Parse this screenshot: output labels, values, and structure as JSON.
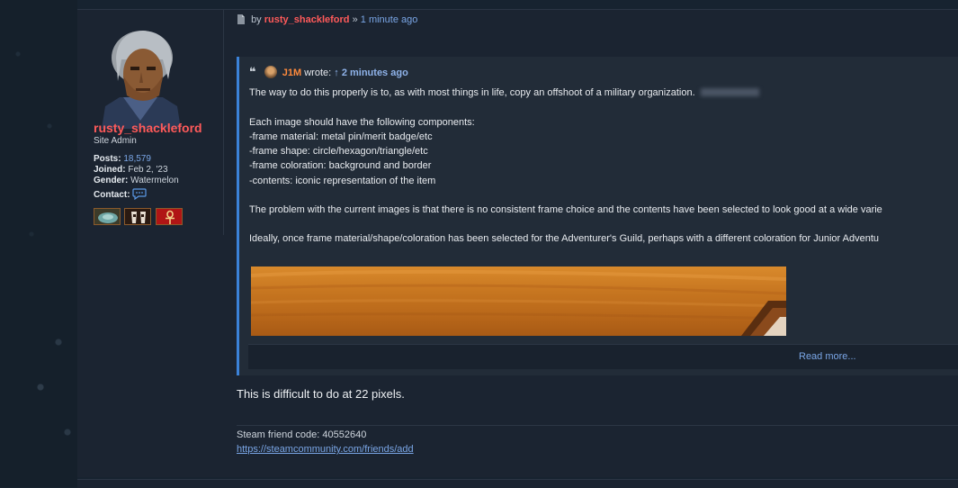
{
  "post": {
    "meta": {
      "prefix": "by",
      "author": "rusty_shackleford",
      "separator": "»",
      "time": "1 minute ago"
    },
    "profile": {
      "username": "rusty_shackleford",
      "rank": "Site Admin",
      "posts_label": "Posts:",
      "posts_value": "18,579",
      "joined_label": "Joined:",
      "joined_value": "Feb 2, '23",
      "gender_label": "Gender:",
      "gender_value": "Watermelon",
      "contact_label": "Contact:",
      "badges": [
        "badge-1",
        "badge-2",
        "badge-3"
      ]
    },
    "quote": {
      "author": "J1M",
      "wrote": "wrote:",
      "arrow": "↑",
      "time": "2 minutes ago",
      "lines": [
        "The way to do this properly is to, as with most things in life, copy an offshoot of a military organization.",
        "Each image should have the following components:",
        "-frame material: metal pin/merit badge/etc",
        "-frame shape: circle/hexagon/triangle/etc",
        "-frame coloration: background and border",
        "-contents: iconic representation of the item",
        "The problem with the current images is that there is no consistent frame choice and the contents have been selected to look good at a wide varie",
        "Ideally, once frame material/shape/coloration has been selected for the Adventurer's Guild, perhaps with a different coloration for Junior Adventu"
      ],
      "read_more": "Read more..."
    },
    "reply": "This is difficult to do at 22 pixels.",
    "signature": {
      "line1": "Steam friend code: 40552640",
      "link": "https://steamcommunity.com/friends/add"
    }
  },
  "colors": {
    "username": "#ff5a5a",
    "quote_author": "#ff8a3c",
    "link": "#7aa6e6",
    "quote_border": "#3b82d8"
  }
}
